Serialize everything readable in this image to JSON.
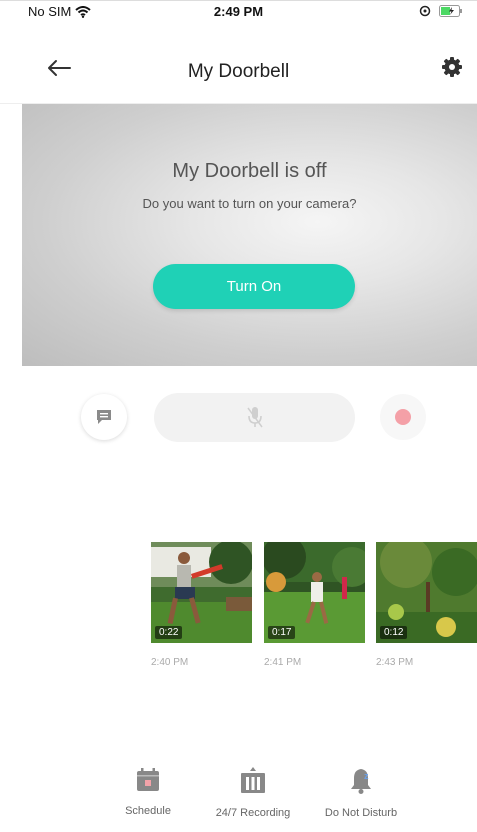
{
  "status_bar": {
    "carrier": "No SIM",
    "time": "2:49 PM"
  },
  "nav": {
    "title": "My Doorbell"
  },
  "camera": {
    "title": "My Doorbell is off",
    "subtitle": "Do you want to turn on your camera?",
    "button_label": "Turn On"
  },
  "clips": [
    {
      "duration": "0:22",
      "time": "2:40 PM"
    },
    {
      "duration": "0:17",
      "time": "2:41 PM"
    },
    {
      "duration": "0:12",
      "time": "2:43 PM"
    }
  ],
  "tabs": [
    {
      "label": "Schedule",
      "icon": "calendar-icon"
    },
    {
      "label": "24/7 Recording",
      "icon": "recording-icon"
    },
    {
      "label": "Do Not Disturb",
      "icon": "bell-icon"
    }
  ],
  "colors": {
    "accent": "#1fd1b6",
    "record": "#f4a0a7"
  }
}
